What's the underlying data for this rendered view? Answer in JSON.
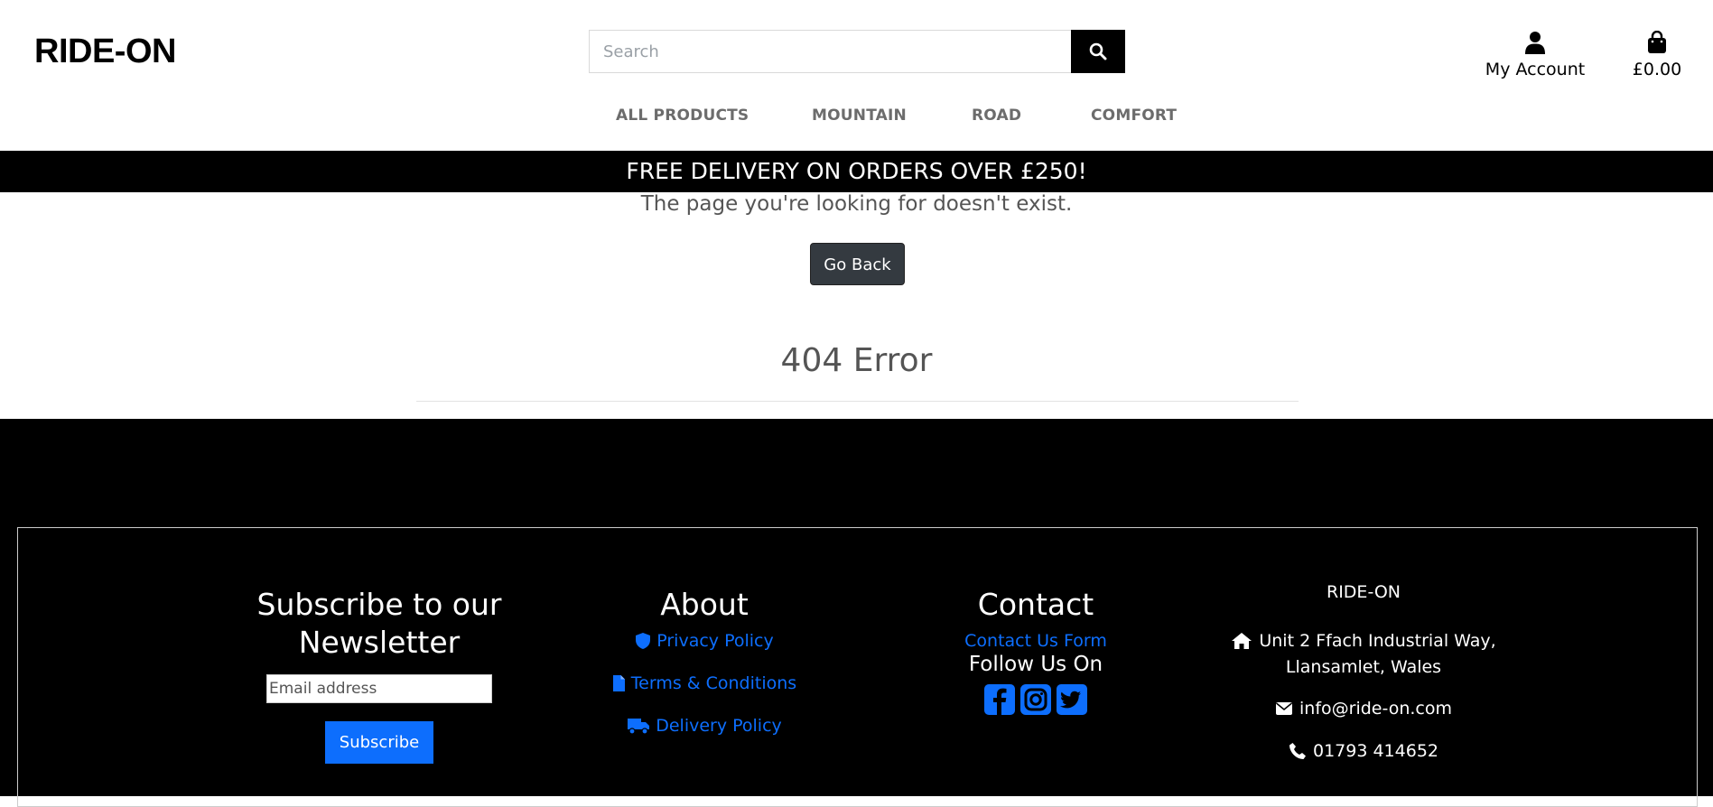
{
  "header": {
    "logo": "RIDE-ON",
    "search_placeholder": "Search",
    "account_label": "My Account",
    "bag_total": "£0.00",
    "icons": {
      "search": "search-icon",
      "account": "user-icon",
      "bag": "shopping-bag-icon"
    }
  },
  "nav": {
    "items": [
      {
        "label": "ALL PRODUCTS"
      },
      {
        "label": "MOUNTAIN"
      },
      {
        "label": "ROAD"
      },
      {
        "label": "COMFORT"
      }
    ]
  },
  "banner": {
    "text": "FREE DELIVERY ON ORDERS OVER £250!"
  },
  "main": {
    "message": "The page you're looking for doesn't exist.",
    "go_back_label": "Go Back",
    "error_title": "404 Error"
  },
  "footer": {
    "newsletter": {
      "heading_line1": "Subscribe to our",
      "heading_line2": "Newsletter",
      "email_placeholder": "Email address",
      "subscribe_label": "Subscribe"
    },
    "about": {
      "heading": "About",
      "links": [
        {
          "label": "Privacy Policy",
          "icon": "shield-icon"
        },
        {
          "label": "Terms & Conditions",
          "icon": "file-icon"
        },
        {
          "label": "Delivery Policy",
          "icon": "truck-icon"
        }
      ]
    },
    "contact": {
      "heading": "Contact",
      "form_link": "Contact Us Form",
      "follow_label": "Follow Us On",
      "social": [
        "facebook-icon",
        "instagram-icon",
        "twitter-icon"
      ]
    },
    "company": {
      "name": "RIDE-ON",
      "address_line1": "Unit 2 Ffach Industrial Way,",
      "address_line2": "Llansamlet, Wales",
      "email": "info@ride-on.com",
      "phone": "01793 414652"
    }
  },
  "colors": {
    "accent": "#0d6efd",
    "banner_bg": "#000000",
    "button_dark": "#343a40"
  }
}
